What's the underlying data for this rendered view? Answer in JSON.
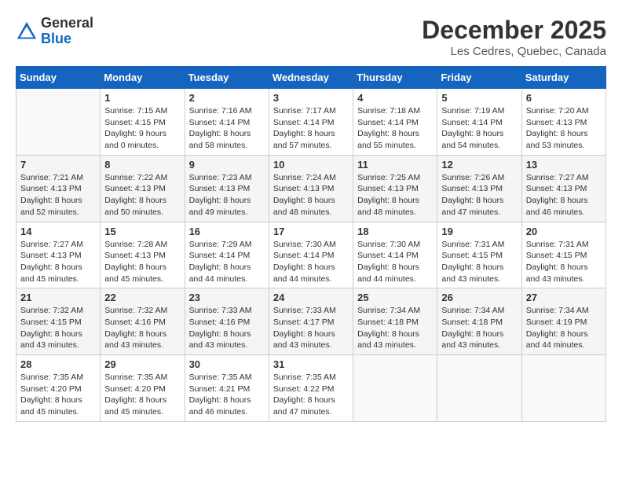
{
  "header": {
    "logo_line1": "General",
    "logo_line2": "Blue",
    "month_year": "December 2025",
    "location": "Les Cedres, Quebec, Canada"
  },
  "weekdays": [
    "Sunday",
    "Monday",
    "Tuesday",
    "Wednesday",
    "Thursday",
    "Friday",
    "Saturday"
  ],
  "weeks": [
    [
      {
        "day": "",
        "info": ""
      },
      {
        "day": "1",
        "info": "Sunrise: 7:15 AM\nSunset: 4:15 PM\nDaylight: 9 hours\nand 0 minutes."
      },
      {
        "day": "2",
        "info": "Sunrise: 7:16 AM\nSunset: 4:14 PM\nDaylight: 8 hours\nand 58 minutes."
      },
      {
        "day": "3",
        "info": "Sunrise: 7:17 AM\nSunset: 4:14 PM\nDaylight: 8 hours\nand 57 minutes."
      },
      {
        "day": "4",
        "info": "Sunrise: 7:18 AM\nSunset: 4:14 PM\nDaylight: 8 hours\nand 55 minutes."
      },
      {
        "day": "5",
        "info": "Sunrise: 7:19 AM\nSunset: 4:14 PM\nDaylight: 8 hours\nand 54 minutes."
      },
      {
        "day": "6",
        "info": "Sunrise: 7:20 AM\nSunset: 4:13 PM\nDaylight: 8 hours\nand 53 minutes."
      }
    ],
    [
      {
        "day": "7",
        "info": "Sunrise: 7:21 AM\nSunset: 4:13 PM\nDaylight: 8 hours\nand 52 minutes."
      },
      {
        "day": "8",
        "info": "Sunrise: 7:22 AM\nSunset: 4:13 PM\nDaylight: 8 hours\nand 50 minutes."
      },
      {
        "day": "9",
        "info": "Sunrise: 7:23 AM\nSunset: 4:13 PM\nDaylight: 8 hours\nand 49 minutes."
      },
      {
        "day": "10",
        "info": "Sunrise: 7:24 AM\nSunset: 4:13 PM\nDaylight: 8 hours\nand 48 minutes."
      },
      {
        "day": "11",
        "info": "Sunrise: 7:25 AM\nSunset: 4:13 PM\nDaylight: 8 hours\nand 48 minutes."
      },
      {
        "day": "12",
        "info": "Sunrise: 7:26 AM\nSunset: 4:13 PM\nDaylight: 8 hours\nand 47 minutes."
      },
      {
        "day": "13",
        "info": "Sunrise: 7:27 AM\nSunset: 4:13 PM\nDaylight: 8 hours\nand 46 minutes."
      }
    ],
    [
      {
        "day": "14",
        "info": "Sunrise: 7:27 AM\nSunset: 4:13 PM\nDaylight: 8 hours\nand 45 minutes."
      },
      {
        "day": "15",
        "info": "Sunrise: 7:28 AM\nSunset: 4:13 PM\nDaylight: 8 hours\nand 45 minutes."
      },
      {
        "day": "16",
        "info": "Sunrise: 7:29 AM\nSunset: 4:14 PM\nDaylight: 8 hours\nand 44 minutes."
      },
      {
        "day": "17",
        "info": "Sunrise: 7:30 AM\nSunset: 4:14 PM\nDaylight: 8 hours\nand 44 minutes."
      },
      {
        "day": "18",
        "info": "Sunrise: 7:30 AM\nSunset: 4:14 PM\nDaylight: 8 hours\nand 44 minutes."
      },
      {
        "day": "19",
        "info": "Sunrise: 7:31 AM\nSunset: 4:15 PM\nDaylight: 8 hours\nand 43 minutes."
      },
      {
        "day": "20",
        "info": "Sunrise: 7:31 AM\nSunset: 4:15 PM\nDaylight: 8 hours\nand 43 minutes."
      }
    ],
    [
      {
        "day": "21",
        "info": "Sunrise: 7:32 AM\nSunset: 4:15 PM\nDaylight: 8 hours\nand 43 minutes."
      },
      {
        "day": "22",
        "info": "Sunrise: 7:32 AM\nSunset: 4:16 PM\nDaylight: 8 hours\nand 43 minutes."
      },
      {
        "day": "23",
        "info": "Sunrise: 7:33 AM\nSunset: 4:16 PM\nDaylight: 8 hours\nand 43 minutes."
      },
      {
        "day": "24",
        "info": "Sunrise: 7:33 AM\nSunset: 4:17 PM\nDaylight: 8 hours\nand 43 minutes."
      },
      {
        "day": "25",
        "info": "Sunrise: 7:34 AM\nSunset: 4:18 PM\nDaylight: 8 hours\nand 43 minutes."
      },
      {
        "day": "26",
        "info": "Sunrise: 7:34 AM\nSunset: 4:18 PM\nDaylight: 8 hours\nand 43 minutes."
      },
      {
        "day": "27",
        "info": "Sunrise: 7:34 AM\nSunset: 4:19 PM\nDaylight: 8 hours\nand 44 minutes."
      }
    ],
    [
      {
        "day": "28",
        "info": "Sunrise: 7:35 AM\nSunset: 4:20 PM\nDaylight: 8 hours\nand 45 minutes."
      },
      {
        "day": "29",
        "info": "Sunrise: 7:35 AM\nSunset: 4:20 PM\nDaylight: 8 hours\nand 45 minutes."
      },
      {
        "day": "30",
        "info": "Sunrise: 7:35 AM\nSunset: 4:21 PM\nDaylight: 8 hours\nand 46 minutes."
      },
      {
        "day": "31",
        "info": "Sunrise: 7:35 AM\nSunset: 4:22 PM\nDaylight: 8 hours\nand 47 minutes."
      },
      {
        "day": "",
        "info": ""
      },
      {
        "day": "",
        "info": ""
      },
      {
        "day": "",
        "info": ""
      }
    ]
  ]
}
